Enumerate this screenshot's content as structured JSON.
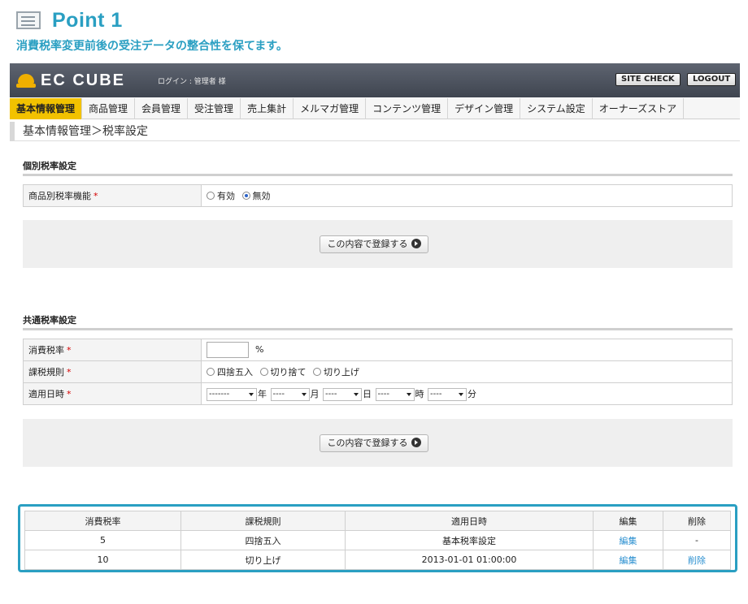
{
  "point": {
    "title": "Point 1",
    "subtitle": "消費税率変更前後の受注データの整合性を保てます。"
  },
  "header": {
    "logo": "EC CUBE",
    "login_text": "ログイン : 管理者 様",
    "site_check": "SITE CHECK",
    "logout": "LOGOUT"
  },
  "nav": {
    "items": [
      "基本情報管理",
      "商品管理",
      "会員管理",
      "受注管理",
      "売上集計",
      "メルマガ管理",
      "コンテンツ管理",
      "デザイン管理",
      "システム設定",
      "オーナーズストア"
    ],
    "active_index": 0
  },
  "breadcrumb": "基本情報管理＞税率設定",
  "individual": {
    "title": "個別税率設定",
    "label": "商品別税率機能",
    "required": "*",
    "options": [
      "有効",
      "無効"
    ],
    "selected": "無効"
  },
  "submit_label": "この内容で登録する",
  "common": {
    "title": "共通税率設定",
    "rate_label": "消費税率",
    "rate_unit": "%",
    "rule_label": "課税規則",
    "rule_options": [
      "四捨五入",
      "切り捨て",
      "切り上げ"
    ],
    "date_label": "適用日時",
    "required": "*",
    "date_fields": [
      {
        "value": "-------",
        "unit": "年"
      },
      {
        "value": "----",
        "unit": "月"
      },
      {
        "value": "----",
        "unit": "日"
      },
      {
        "value": "----",
        "unit": "時"
      },
      {
        "value": "----",
        "unit": "分"
      }
    ]
  },
  "list": {
    "headers": [
      "消費税率",
      "課税規則",
      "適用日時",
      "編集",
      "削除"
    ],
    "rows": [
      {
        "rate": "5",
        "rule": "四捨五入",
        "date": "基本税率設定",
        "edit": "編集",
        "delete": "-"
      },
      {
        "rate": "10",
        "rule": "切り上げ",
        "date": "2013-01-01 01:00:00",
        "edit": "編集",
        "delete": "削除"
      }
    ]
  },
  "colors": {
    "accent": "#2a9fc2",
    "nav_active": "#f2c200",
    "header_bg": "#4a505b",
    "required": "#d40000",
    "link": "#2a8fd0"
  }
}
